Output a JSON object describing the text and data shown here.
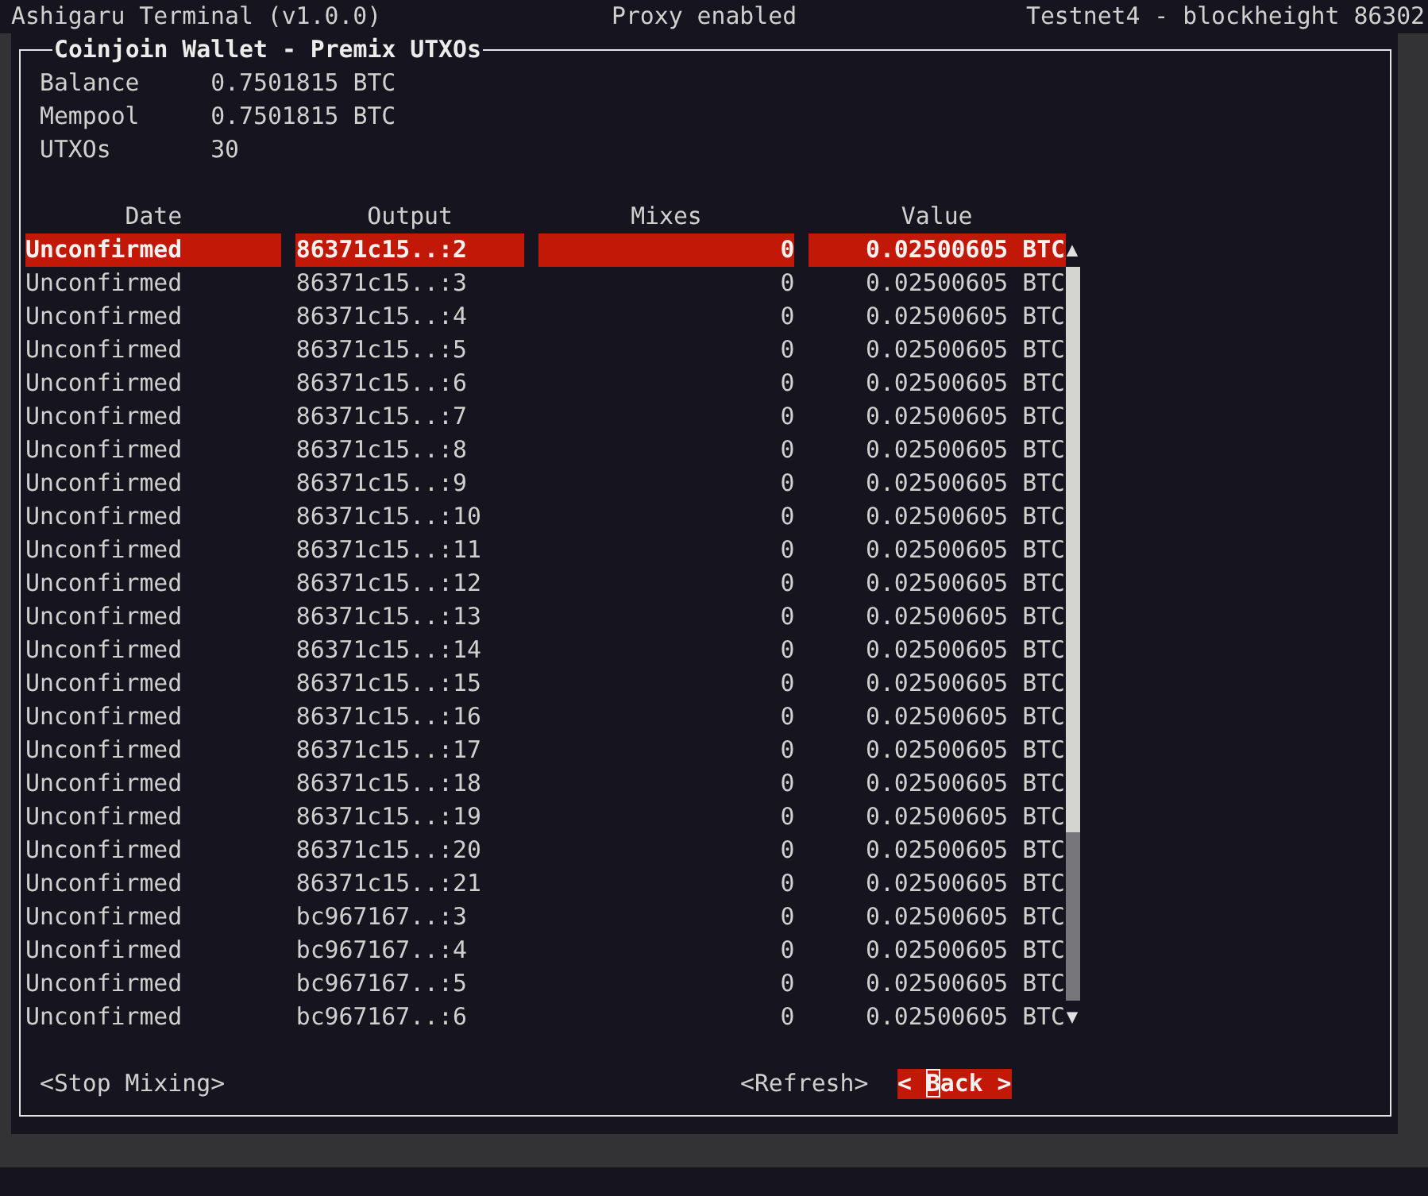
{
  "top_bar": {
    "app_title": "Ashigaru Terminal (v1.0.0)",
    "proxy_status": "Proxy enabled",
    "network_status": "Testnet4 - blockheight 86302"
  },
  "panel": {
    "title": "Coinjoin Wallet - Premix UTXOs",
    "summary": [
      {
        "label": "Balance",
        "value": "0.7501815 BTC"
      },
      {
        "label": "Mempool",
        "value": "0.7501815 BTC"
      },
      {
        "label": "UTXOs",
        "value": "30"
      }
    ],
    "table": {
      "columns": [
        "Date",
        "Output",
        "Mixes",
        "Value"
      ],
      "rows": [
        {
          "date": "Unconfirmed",
          "output": "86371c15..:2",
          "mixes": "0",
          "value": "0.02500605 BTC",
          "selected": true
        },
        {
          "date": "Unconfirmed",
          "output": "86371c15..:3",
          "mixes": "0",
          "value": "0.02500605 BTC",
          "selected": false
        },
        {
          "date": "Unconfirmed",
          "output": "86371c15..:4",
          "mixes": "0",
          "value": "0.02500605 BTC",
          "selected": false
        },
        {
          "date": "Unconfirmed",
          "output": "86371c15..:5",
          "mixes": "0",
          "value": "0.02500605 BTC",
          "selected": false
        },
        {
          "date": "Unconfirmed",
          "output": "86371c15..:6",
          "mixes": "0",
          "value": "0.02500605 BTC",
          "selected": false
        },
        {
          "date": "Unconfirmed",
          "output": "86371c15..:7",
          "mixes": "0",
          "value": "0.02500605 BTC",
          "selected": false
        },
        {
          "date": "Unconfirmed",
          "output": "86371c15..:8",
          "mixes": "0",
          "value": "0.02500605 BTC",
          "selected": false
        },
        {
          "date": "Unconfirmed",
          "output": "86371c15..:9",
          "mixes": "0",
          "value": "0.02500605 BTC",
          "selected": false
        },
        {
          "date": "Unconfirmed",
          "output": "86371c15..:10",
          "mixes": "0",
          "value": "0.02500605 BTC",
          "selected": false
        },
        {
          "date": "Unconfirmed",
          "output": "86371c15..:11",
          "mixes": "0",
          "value": "0.02500605 BTC",
          "selected": false
        },
        {
          "date": "Unconfirmed",
          "output": "86371c15..:12",
          "mixes": "0",
          "value": "0.02500605 BTC",
          "selected": false
        },
        {
          "date": "Unconfirmed",
          "output": "86371c15..:13",
          "mixes": "0",
          "value": "0.02500605 BTC",
          "selected": false
        },
        {
          "date": "Unconfirmed",
          "output": "86371c15..:14",
          "mixes": "0",
          "value": "0.02500605 BTC",
          "selected": false
        },
        {
          "date": "Unconfirmed",
          "output": "86371c15..:15",
          "mixes": "0",
          "value": "0.02500605 BTC",
          "selected": false
        },
        {
          "date": "Unconfirmed",
          "output": "86371c15..:16",
          "mixes": "0",
          "value": "0.02500605 BTC",
          "selected": false
        },
        {
          "date": "Unconfirmed",
          "output": "86371c15..:17",
          "mixes": "0",
          "value": "0.02500605 BTC",
          "selected": false
        },
        {
          "date": "Unconfirmed",
          "output": "86371c15..:18",
          "mixes": "0",
          "value": "0.02500605 BTC",
          "selected": false
        },
        {
          "date": "Unconfirmed",
          "output": "86371c15..:19",
          "mixes": "0",
          "value": "0.02500605 BTC",
          "selected": false
        },
        {
          "date": "Unconfirmed",
          "output": "86371c15..:20",
          "mixes": "0",
          "value": "0.02500605 BTC",
          "selected": false
        },
        {
          "date": "Unconfirmed",
          "output": "86371c15..:21",
          "mixes": "0",
          "value": "0.02500605 BTC",
          "selected": false
        },
        {
          "date": "Unconfirmed",
          "output": "bc967167..:3",
          "mixes": "0",
          "value": "0.02500605 BTC",
          "selected": false
        },
        {
          "date": "Unconfirmed",
          "output": "bc967167..:4",
          "mixes": "0",
          "value": "0.02500605 BTC",
          "selected": false
        },
        {
          "date": "Unconfirmed",
          "output": "bc967167..:5",
          "mixes": "0",
          "value": "0.02500605 BTC",
          "selected": false
        },
        {
          "date": "Unconfirmed",
          "output": "bc967167..:6",
          "mixes": "0",
          "value": "0.02500605 BTC",
          "selected": false
        }
      ],
      "scrollbar": {
        "up_arrow": "▲",
        "down_arrow": "▼"
      }
    },
    "buttons": [
      {
        "label": "<Stop Mixing>",
        "selected": false
      },
      {
        "label": "<Refresh>",
        "selected": false
      },
      {
        "label": "< Back >",
        "selected": true
      }
    ]
  }
}
